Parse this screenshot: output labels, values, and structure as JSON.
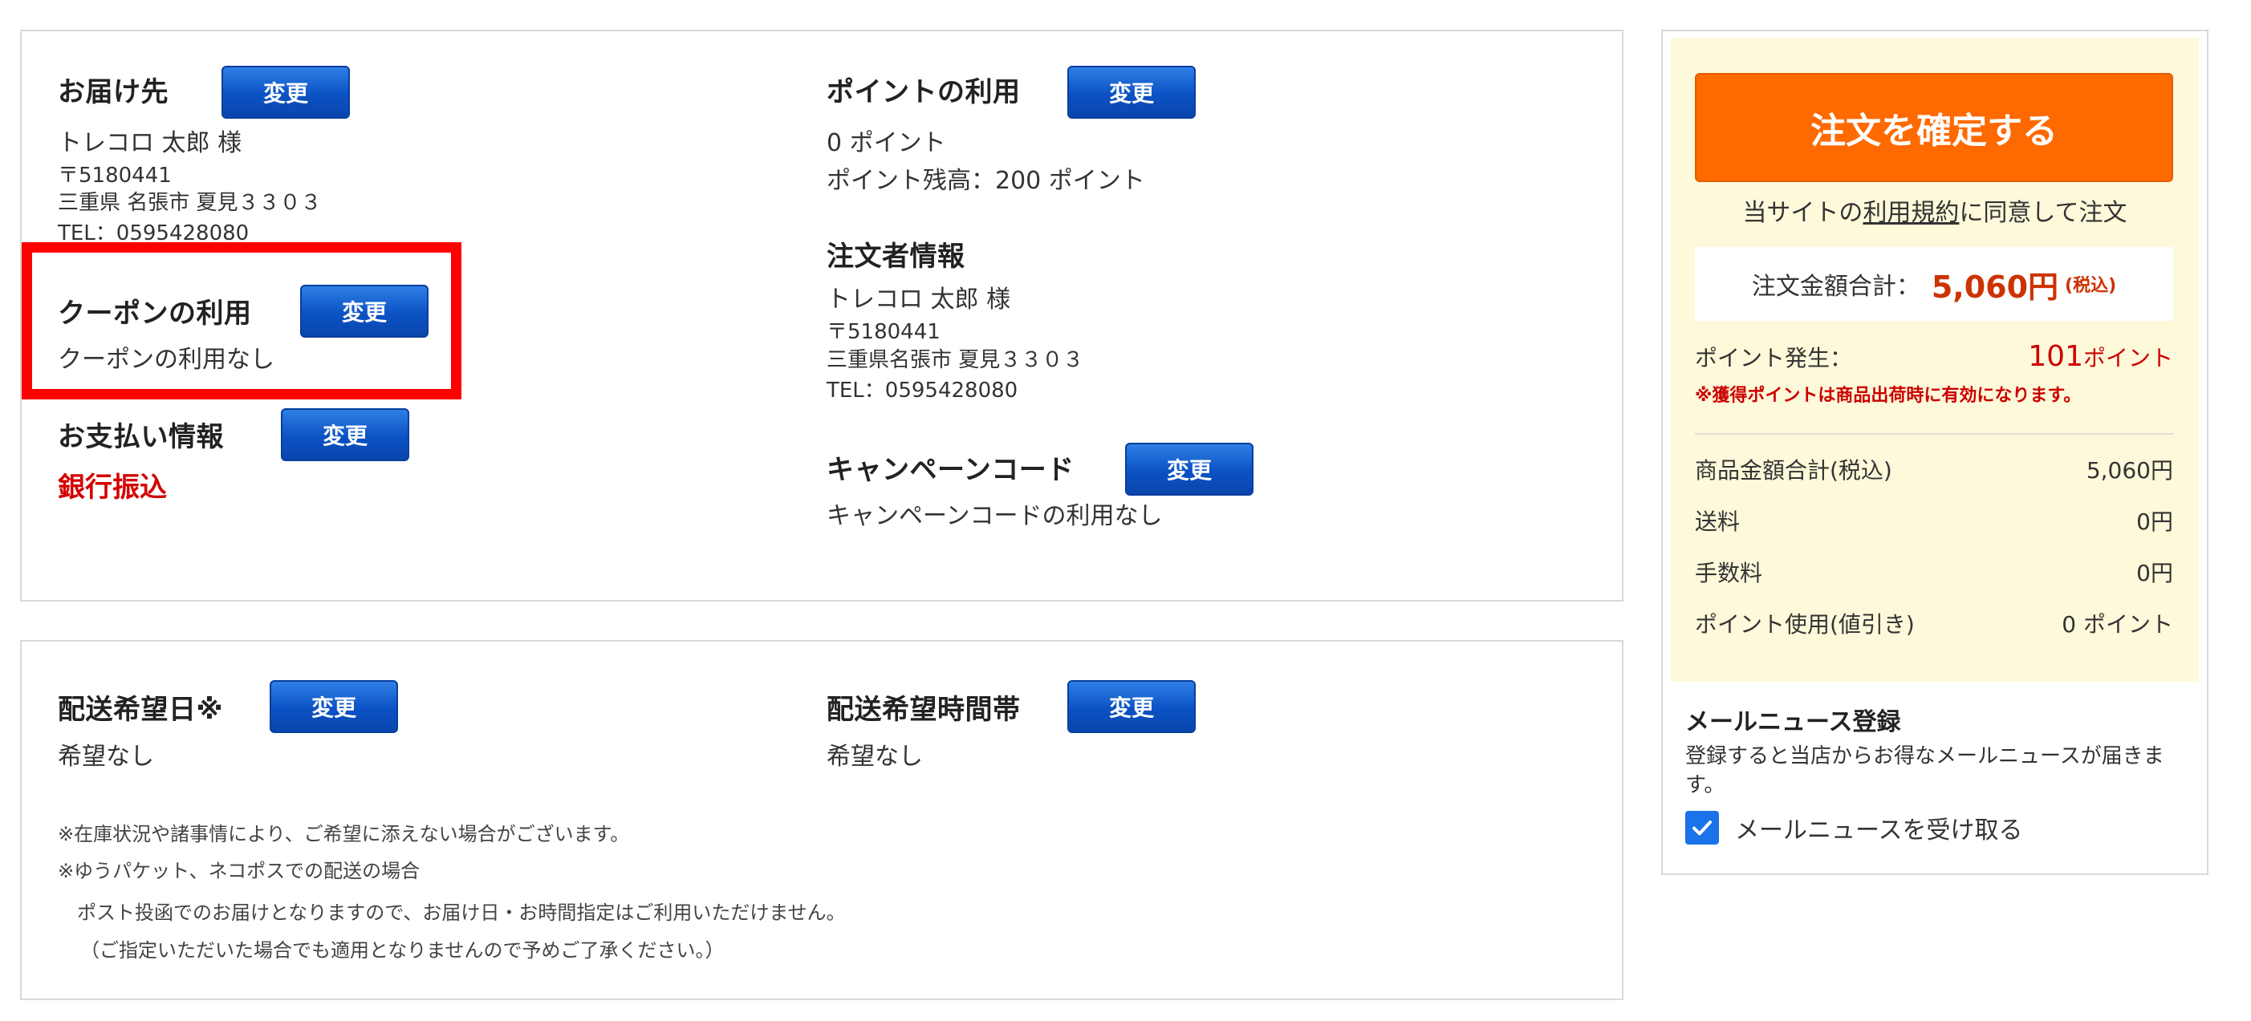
{
  "order": {
    "change_label": "変更",
    "shipping_address": {
      "title": "お届け先",
      "name": "トレコロ 太郎 様",
      "postal": "〒5180441",
      "address": "三重県 名張市 夏見３３０３",
      "tel": "TEL：0595428080"
    },
    "coupon": {
      "title": "クーポンの利用",
      "value": "クーポンの利用なし",
      "highlight_color": "#ff0000"
    },
    "payment": {
      "title": "お支払い情報",
      "method": "銀行振込"
    },
    "points": {
      "title": "ポイントの利用",
      "used": "0 ポイント",
      "balance": "ポイント残高：200 ポイント"
    },
    "orderer": {
      "title": "注文者情報",
      "name": "トレコロ 太郎 様",
      "postal": "〒5180441",
      "address": "三重県名張市 夏見３３０３",
      "tel": "TEL：0595428080"
    },
    "campaign": {
      "title": "キャンペーンコード",
      "value": "キャンペーンコードの利用なし"
    }
  },
  "delivery": {
    "date": {
      "title": "配送希望日※",
      "value": "希望なし"
    },
    "time": {
      "title": "配送希望時間帯",
      "value": "希望なし"
    },
    "notes": [
      "※在庫状況や諸事情により、ご希望に添えない場合がございます。",
      "※ゆうパケット、ネコポスでの配送の場合",
      "　ポスト投函でのお届けとなりますので、お届け日・お時間指定はご利用いただけません。",
      "（ご指定いただいた場合でも適用となりませんので予めご了承ください。）"
    ]
  },
  "summary": {
    "confirm_label": "注文を確定する",
    "agree_prefix": "当サイトの",
    "agree_link": "利用規約",
    "agree_suffix": "に同意して注文",
    "total_label": "注文金額合計：",
    "total_amount": "5,060円",
    "total_tax": "(税込)",
    "points_earned_label": "ポイント発生：",
    "points_earned_value": "101",
    "points_earned_unit": "ポイント",
    "points_note": "※獲得ポイントは商品出荷時に有効になります。",
    "rows": [
      {
        "label": "商品金額合計(税込)",
        "value": "5,060円"
      },
      {
        "label": "送料",
        "value": "0円"
      },
      {
        "label": "手数料",
        "value": "0円"
      },
      {
        "label": "ポイント使用(値引き)",
        "value": "0 ポイント"
      }
    ],
    "accent_color": "#ff6a00",
    "price_color": "#cc3300"
  },
  "mail_news": {
    "title": "メールニュース登録",
    "description": "登録すると当店からお得なメールニュースが届きます。",
    "checkbox_label": "メールニュースを受け取る",
    "checked": true
  }
}
